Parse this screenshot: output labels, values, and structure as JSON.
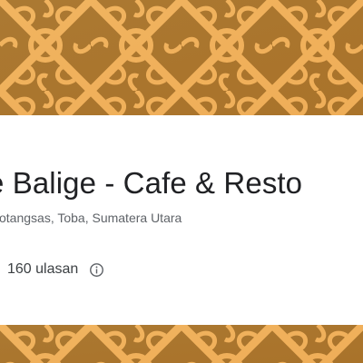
{
  "place": {
    "title": "e Balige - Cafe & Resto",
    "address": "otangsas, Toba, Sumatera Utara",
    "reviews_label": "160 ulasan"
  },
  "icons": {
    "info": "info-circle-icon"
  },
  "colors": {
    "banner_dark": "#8a5a1e",
    "banner_light": "#f2b865",
    "title": "#202124",
    "secondary_text": "#5f6368"
  }
}
